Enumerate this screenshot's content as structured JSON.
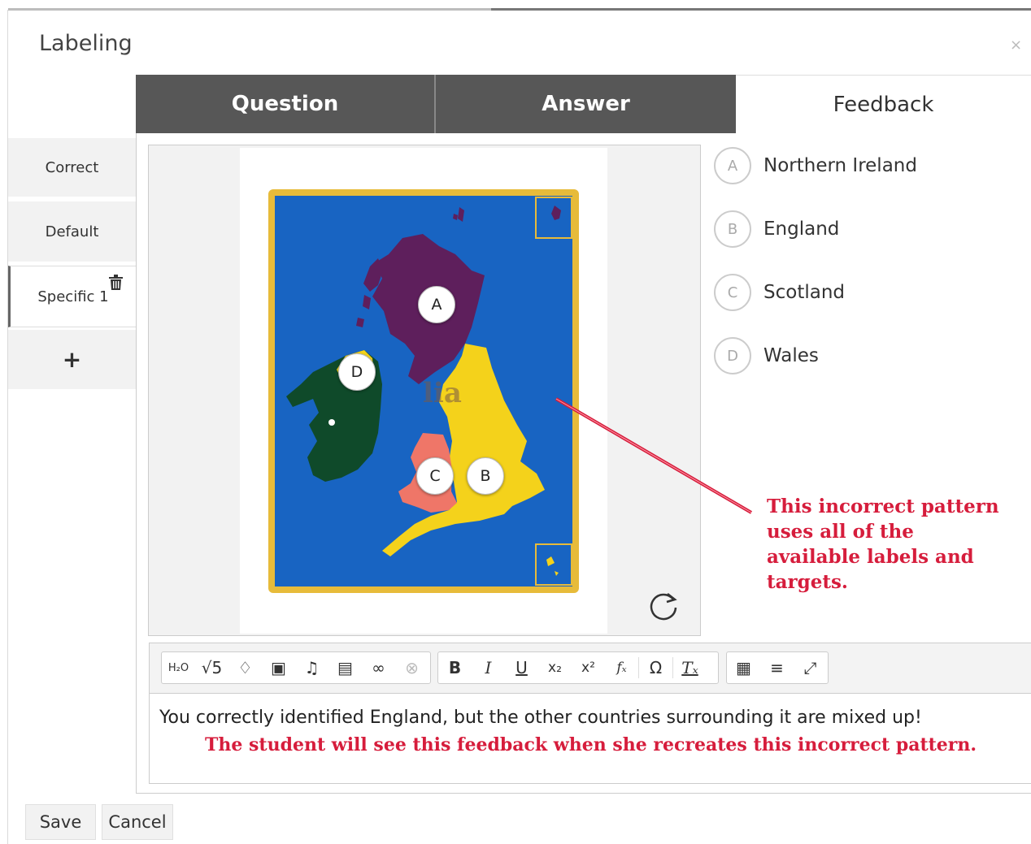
{
  "dialog": {
    "title": "Labeling",
    "close_icon": "×"
  },
  "tabs": [
    {
      "label": "Question",
      "active": false
    },
    {
      "label": "Answer",
      "active": false
    },
    {
      "label": "Feedback",
      "active": true
    }
  ],
  "sidebar": {
    "items": [
      {
        "label": "Correct"
      },
      {
        "label": "Default"
      },
      {
        "label": "Specific 1",
        "selected": true
      }
    ],
    "add_label": "+",
    "delete_icon": "trash-icon"
  },
  "map_labels": [
    {
      "letter": "A"
    },
    {
      "letter": "D"
    },
    {
      "letter": "C"
    },
    {
      "letter": "B"
    }
  ],
  "answers": [
    {
      "letter": "A",
      "label": "Northern Ireland"
    },
    {
      "letter": "B",
      "label": "England"
    },
    {
      "letter": "C",
      "label": "Scotland"
    },
    {
      "letter": "D",
      "label": "Wales"
    }
  ],
  "annotation": "This incorrect pattern uses all of the available labels and targets.",
  "toolbar": {
    "groups": [
      [
        "H₂O",
        "√5",
        "♢",
        "▣",
        "♫",
        "▤",
        "∞",
        "⊗"
      ],
      [
        "B",
        "I",
        "U",
        "x₂",
        "x²",
        "fₓ",
        "|",
        "Ω",
        "|",
        "Tₓ"
      ],
      [
        "▦",
        "≡",
        "⤢"
      ]
    ]
  },
  "editor": {
    "text": "You correctly identified England, but the other countries surrounding it are mixed up!",
    "note": "The student will see this feedback when she recreates this incorrect pattern."
  },
  "buttons": {
    "save": "Save",
    "cancel": "Cancel"
  },
  "colors": {
    "accent_red": "#d61d3c",
    "tab_dark": "#575757",
    "sea": "#1864c2",
    "scotland": "#5e1f5c",
    "england": "#f4d21b",
    "ireland": "#0f4a2a",
    "wales": "#ef7668"
  }
}
